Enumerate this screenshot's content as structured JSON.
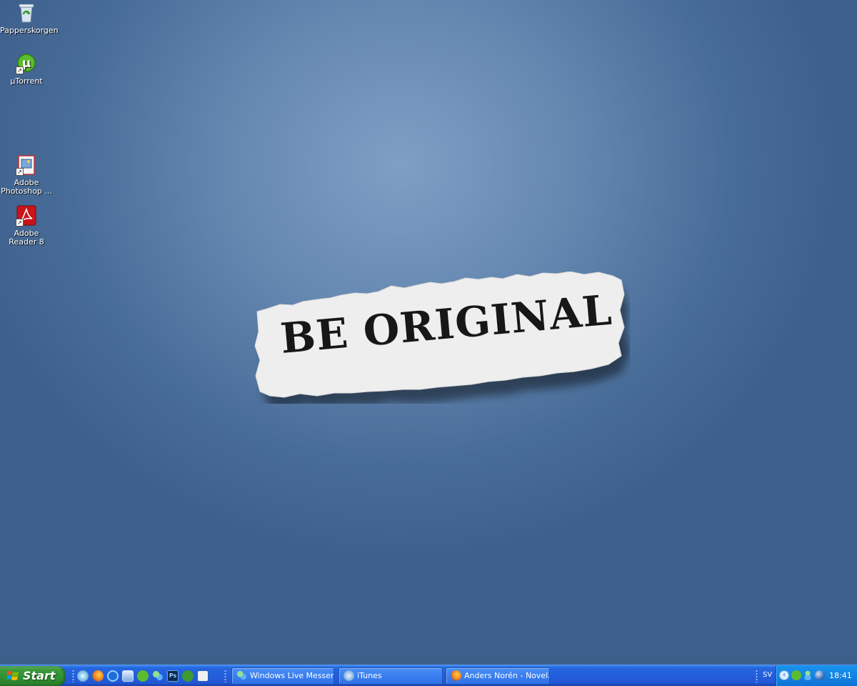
{
  "desktop": {
    "icons": [
      {
        "label": "Papperskorgen"
      },
      {
        "label": "µTorrent"
      },
      {
        "label": "Adobe Photoshop ..."
      },
      {
        "label": "Adobe Reader 8"
      }
    ],
    "wallpaper_text": "BE ORIGINAL",
    "colors": {
      "background": "#5f82ad",
      "paper": "#f1f1f1"
    }
  },
  "taskbar": {
    "start_label": "Start",
    "quick_launch": [
      "itunes-icon",
      "firefox-icon",
      "internet-explorer-icon",
      "show-desktop-icon",
      "utorrent-icon",
      "messenger-icon",
      "photoshop-icon",
      "dreamweaver-icon",
      "word-icon"
    ],
    "photoshop_label": "Ps",
    "buttons": [
      {
        "label": "Windows Live Messen..."
      },
      {
        "label": "iTunes"
      },
      {
        "label": "Anders Norén - Novel..."
      }
    ],
    "language": "SV",
    "clock": "18:41",
    "colors": {
      "bar": "#245edb",
      "start": "#3c9a3c",
      "tray": "#1384e2"
    }
  }
}
